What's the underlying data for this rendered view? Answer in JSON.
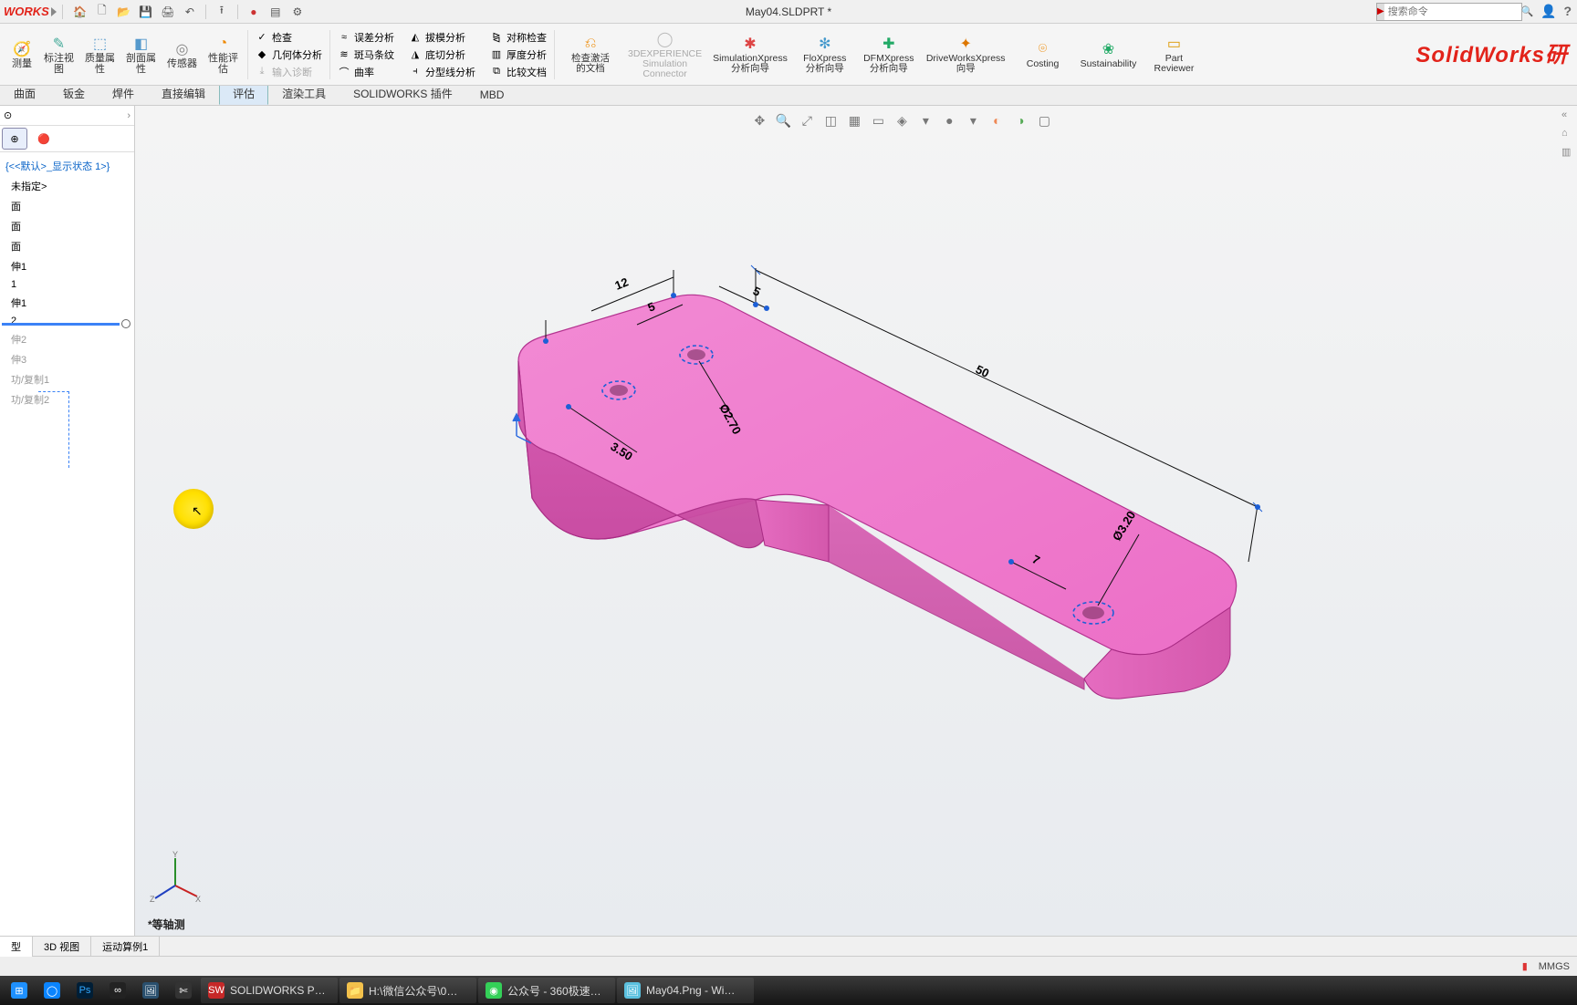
{
  "title": {
    "doc": "May04.SLDPRT *"
  },
  "search": {
    "placeholder": "搜索命令"
  },
  "logo": "WORKS",
  "brand": "SolidWorks研",
  "ribbon": {
    "items": [
      {
        "label": "测量",
        "ico": "🧭",
        "c": "#2a7"
      },
      {
        "label": "标注视\n图",
        "ico": "✎",
        "c": "#4a9"
      },
      {
        "label": "质量属\n性",
        "ico": "⬚",
        "c": "#59c"
      },
      {
        "label": "剖面属\n性",
        "ico": "◧",
        "c": "#59c"
      },
      {
        "label": "传感器",
        "ico": "◎",
        "c": "#888"
      },
      {
        "label": "性能评\n估",
        "ico": "◔",
        "c": "#e80"
      }
    ],
    "stack1": [
      {
        "label": "检查",
        "ico": "✓"
      },
      {
        "label": "几何体分析",
        "ico": "◆"
      },
      {
        "label": "输入诊断",
        "ico": "⤓",
        "disabled": true
      }
    ],
    "stack2": [
      {
        "label": "误差分析",
        "ico": "≈"
      },
      {
        "label": "斑马条纹",
        "ico": "≋"
      },
      {
        "label": "曲率",
        "ico": "⌒"
      }
    ],
    "stack3": [
      {
        "label": "拔模分析",
        "ico": "◭"
      },
      {
        "label": "底切分析",
        "ico": "◮"
      },
      {
        "label": "分型线分析",
        "ico": "⫞"
      }
    ],
    "stack4": [
      {
        "label": "对称检查",
        "ico": "⧎"
      },
      {
        "label": "厚度分析",
        "ico": "▥"
      },
      {
        "label": "比较文档",
        "ico": "⧉"
      }
    ],
    "big": [
      {
        "label": "检查激活\n的文档",
        "ico": "⎌",
        "c": "#e80"
      },
      {
        "label": "3DEXPERIENCE\nSimulation\nConnector",
        "ico": "◯",
        "c": "#bbb",
        "disabled": true
      },
      {
        "label": "SimulationXpress\n分析向导",
        "ico": "✱",
        "c": "#d44"
      },
      {
        "label": "FloXpress\n分析向导",
        "ico": "✻",
        "c": "#49c"
      },
      {
        "label": "DFMXpress\n分析向导",
        "ico": "✚",
        "c": "#2a6"
      },
      {
        "label": "DriveWorksXpress\n向导",
        "ico": "✦",
        "c": "#d70"
      },
      {
        "label": "Costing",
        "ico": "⌾",
        "c": "#e80"
      },
      {
        "label": "Sustainability",
        "ico": "❀",
        "c": "#2a6"
      },
      {
        "label": "Part\nReviewer",
        "ico": "▭",
        "c": "#d90"
      }
    ]
  },
  "tabs": [
    "曲面",
    "钣金",
    "焊件",
    "直接编辑",
    "评估",
    "渲染工具",
    "SOLIDWORKS 插件",
    "MBD"
  ],
  "active_tab": 4,
  "tree": {
    "config": "{<<默认>_显示状态 1>}",
    "nodes": [
      {
        "t": "未指定>"
      },
      {
        "t": "面"
      },
      {
        "t": "面"
      },
      {
        "t": "面"
      },
      {
        "t": "伸1",
        "link": true
      },
      {
        "t": "1"
      },
      {
        "t": "伸1"
      },
      {
        "t": "2",
        "rollback": true
      },
      {
        "t": "伸2",
        "dim": true
      },
      {
        "t": "伸3",
        "dim": true
      },
      {
        "t": "功/复制1",
        "dim": true
      },
      {
        "t": "功/复制2",
        "dim": true
      }
    ]
  },
  "dims": {
    "d12": "12",
    "d5a": "5",
    "d5b": "5",
    "d50": "50",
    "d270": "Ø2.70",
    "d350": "3.50",
    "d7": "7",
    "d320": "Ø3.20"
  },
  "view_label": "*等轴测",
  "bottom_tabs": [
    "型",
    "3D 视图",
    "运动算例1"
  ],
  "status": {
    "units": "MMGS"
  },
  "taskbar": [
    {
      "label": "",
      "ico": "⊞",
      "bg": "#1e90ff"
    },
    {
      "label": "",
      "ico": "◯",
      "bg": "#0a84ff"
    },
    {
      "label": "",
      "ico": "Ps",
      "bg": "#001e36",
      "fg": "#31a8ff"
    },
    {
      "label": "",
      "ico": "∞",
      "bg": "#222"
    },
    {
      "label": "",
      "ico": "🖼",
      "bg": "#2a506e"
    },
    {
      "label": "",
      "ico": "✄",
      "bg": "#333"
    },
    {
      "label": "SOLIDWORKS P…",
      "ico": "SW",
      "bg": "#c62828",
      "wide": true
    },
    {
      "label": "H:\\微信公众号\\0…",
      "ico": "📁",
      "bg": "#f3c14b",
      "wide": true
    },
    {
      "label": "公众号 - 360极速…",
      "ico": "◉",
      "bg": "#34d058",
      "wide": true
    },
    {
      "label": "May04.Png - Wi…",
      "ico": "🖼",
      "bg": "#5bc0de",
      "wide": true
    }
  ]
}
